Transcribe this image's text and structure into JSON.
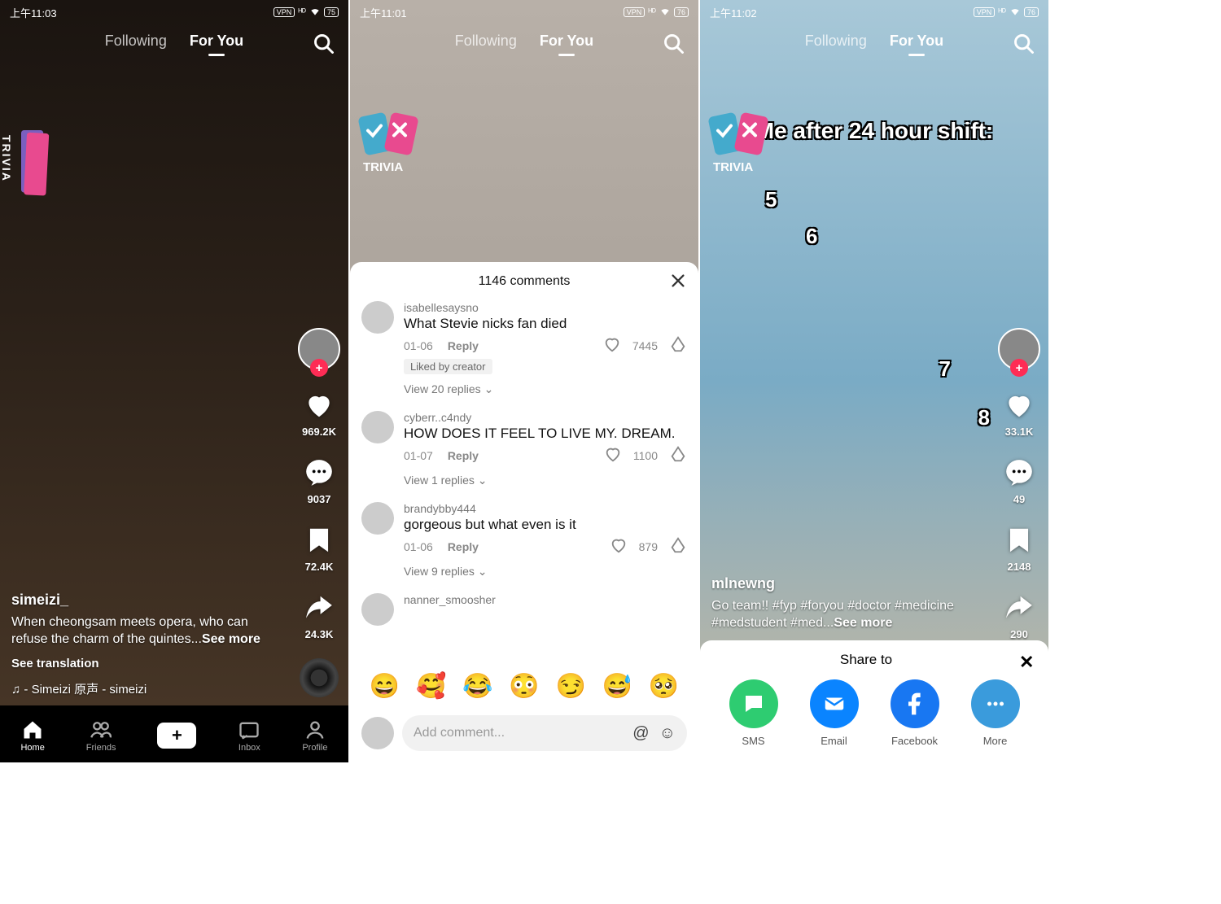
{
  "screens": [
    {
      "time": "上午11:03",
      "battery": "75",
      "vpn": "VPN",
      "tabs": {
        "following": "Following",
        "foryou": "For You"
      },
      "trivia_label": "TRIVIA",
      "user": "simeizi_",
      "caption_prefix": "When cheongsam meets opera, who can refuse the charm of the quintes...",
      "see_more": "See more",
      "see_translation": "See translation",
      "sound": "♫ - Simeizi  原声 - simeizi",
      "rail": {
        "likes": "969.2K",
        "comments": "9037",
        "saves": "72.4K",
        "shares": "24.3K"
      },
      "bottomnav": [
        "Home",
        "Friends",
        "",
        "Inbox",
        "Profile"
      ]
    },
    {
      "time": "上午11:01",
      "battery": "76",
      "vpn": "VPN",
      "tabs": {
        "following": "Following",
        "foryou": "For You"
      },
      "trivia_label": "TRIVIA",
      "comment_sheet": {
        "title": "1146 comments",
        "comments": [
          {
            "user": "isabellesaysno",
            "text": "What Stevie nicks fan died",
            "date": "01-06",
            "reply": "Reply",
            "likes": "7445",
            "liked_by": "Liked by creator",
            "view_replies": "View 20 replies"
          },
          {
            "user": "cyberr..c4ndy",
            "text": "HOW DOES IT FEEL TO LIVE MY. DREAM.",
            "date": "01-07",
            "reply": "Reply",
            "likes": "1100",
            "view_replies": "View 1 replies"
          },
          {
            "user": "brandybby444",
            "text": "gorgeous but what even is it",
            "date": "01-06",
            "reply": "Reply",
            "likes": "879",
            "view_replies": "View 9 replies"
          },
          {
            "user": "nanner_smoosher",
            "text": "",
            "date": "",
            "reply": "",
            "likes": ""
          }
        ],
        "emojis": [
          "😄",
          "🥰",
          "😂",
          "😳",
          "😏",
          "😅",
          "🥺"
        ],
        "placeholder": "Add comment..."
      }
    },
    {
      "time": "上午11:02",
      "battery": "76",
      "vpn": "VPN",
      "tabs": {
        "following": "Following",
        "foryou": "For You"
      },
      "trivia_label": "TRIVIA",
      "video_text": "Me after 24 hour shift:",
      "numbers": [
        "5",
        "6",
        "7",
        "8"
      ],
      "user": "mlnewng",
      "caption_prefix": "Go team!! #fyp #foryou #doctor #medicine #medstudent #med...",
      "see_more": "See more",
      "rail": {
        "likes": "33.1K",
        "comments": "49",
        "saves": "2148",
        "shares": "290"
      },
      "share": {
        "title": "Share to",
        "items": [
          {
            "label": "SMS",
            "class": "c-sms",
            "icon": "chat"
          },
          {
            "label": "Email",
            "class": "c-email",
            "icon": "mail"
          },
          {
            "label": "Facebook",
            "class": "c-fb",
            "icon": "fb"
          },
          {
            "label": "More",
            "class": "c-more",
            "icon": "dots"
          }
        ]
      }
    }
  ]
}
